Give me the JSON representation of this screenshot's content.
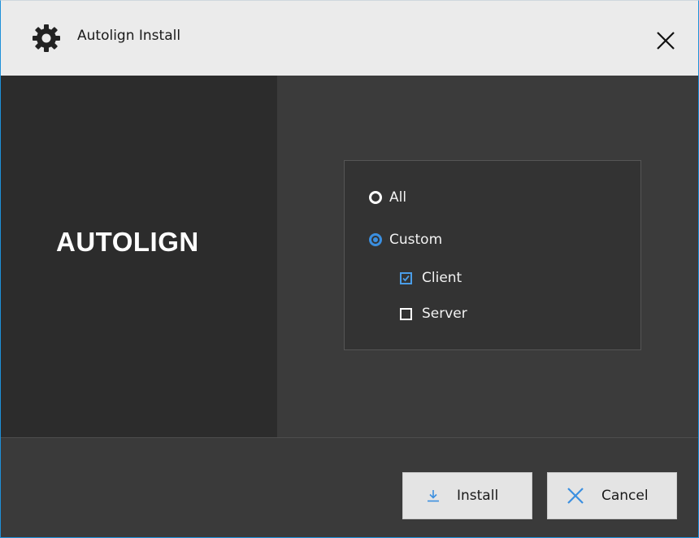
{
  "window": {
    "title": "Autolign Install",
    "title_icon": "gear-icon",
    "close_icon": "close-icon"
  },
  "brand": {
    "text": "AUTOLIGN"
  },
  "options": {
    "all_label": "All",
    "custom_label": "Custom",
    "selected": "Custom",
    "components": [
      {
        "label": "Client",
        "checked": true
      },
      {
        "label": "Server",
        "checked": false
      }
    ]
  },
  "footer": {
    "install_label": "Install",
    "install_icon": "download-icon",
    "cancel_label": "Cancel",
    "cancel_icon": "close-icon"
  },
  "colors": {
    "accent": "#3b8fe0",
    "title_bar": "#ebebeb",
    "left_panel": "#2c2c2c",
    "right_panel": "#3b3b3b"
  }
}
